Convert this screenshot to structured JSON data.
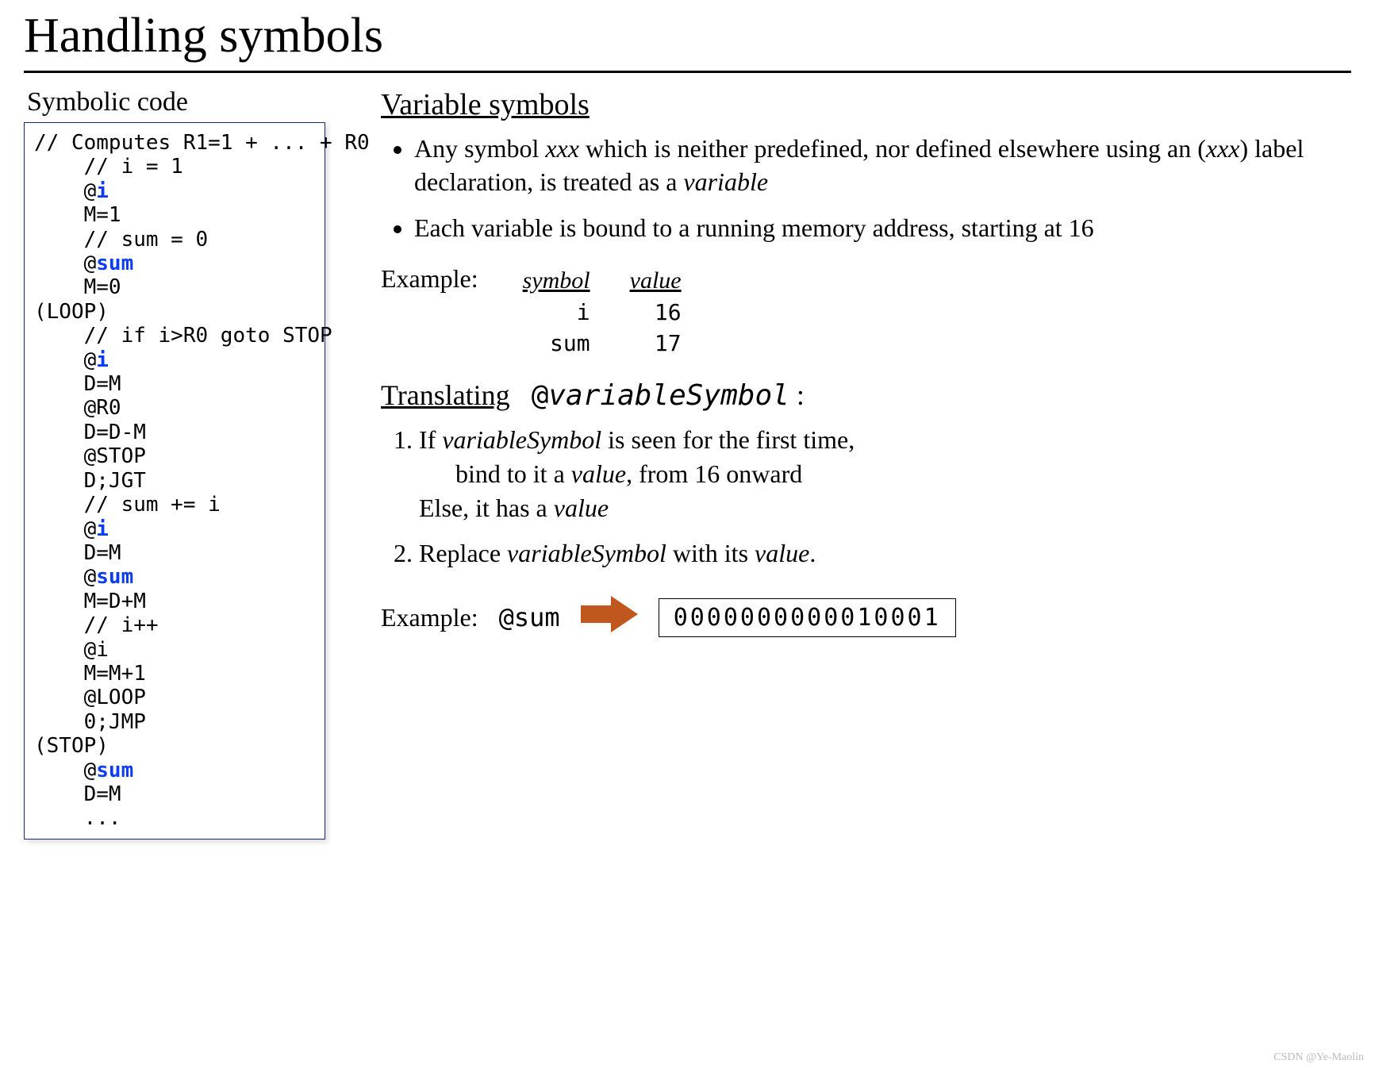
{
  "title": "Handling symbols",
  "left": {
    "heading": "Symbolic code",
    "code": {
      "l1": "// Computes R1=1 + ... + R0",
      "l2": "    // i = 1",
      "l3a": "    @",
      "l3b": "i",
      "l4": "    M=1",
      "l5": "    // sum = 0",
      "l6a": "    @",
      "l6b": "sum",
      "l7": "    M=0",
      "l8": "(LOOP)",
      "l9": "    // if i>R0 goto STOP",
      "l10a": "    @",
      "l10b": "i",
      "l11": "    D=M",
      "l12": "    @R0",
      "l13": "    D=D-M",
      "l14": "    @STOP",
      "l15": "    D;JGT",
      "l16": "    // sum += i",
      "l17a": "    @",
      "l17b": "i",
      "l18": "    D=M",
      "l19a": "    @",
      "l19b": "sum",
      "l20": "    M=D+M",
      "l21": "    // i++",
      "l22": "    @i",
      "l23": "    M=M+1",
      "l24": "    @LOOP",
      "l25": "    0;JMP",
      "l26": "(STOP)",
      "l27a": "    @",
      "l27b": "sum",
      "l28": "    D=M",
      "l29": "    ..."
    }
  },
  "right": {
    "sect1": "Variable symbols",
    "b1a": "Any symbol ",
    "b1b": "xxx",
    "b1c": " which is neither predefined, nor defined elsewhere using an (",
    "b1d": "xxx",
    "b1e": ") label declaration, is treated as a ",
    "b1f": "variable",
    "b2": "Each variable is bound to a running memory address, starting at 16",
    "exlabel": "Example:",
    "tab": {
      "h1": "symbol",
      "h2": "value",
      "r1s": "i",
      "r1v": "16",
      "r2s": "sum",
      "r2v": "17"
    },
    "transLabel": "Translating",
    "transAt": "@",
    "transSym": "variableSymbol",
    "transColon": ":",
    "s1a": "If ",
    "s1b": "variableSymbol",
    "s1c": " is seen for the first time,",
    "s1d": "bind to it a ",
    "s1e": "value",
    "s1f": ", from 16 onward",
    "s1g": "Else, it has a ",
    "s1h": "value",
    "s2a": "Replace ",
    "s2b": "variableSymbol",
    "s2c": " with its ",
    "s2d": "value",
    "s2e": ".",
    "ex2label": "Example:",
    "ex2at": "@sum",
    "ex2bin": "0000000000010001"
  },
  "watermark": "CSDN @Ye-Maolin"
}
